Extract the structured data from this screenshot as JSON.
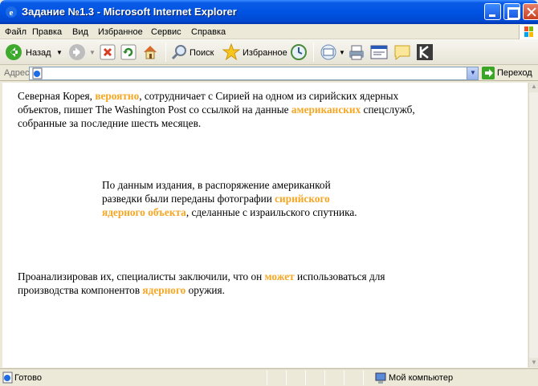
{
  "window": {
    "title": "Задание №1.3 - Microsoft Internet Explorer",
    "icon": "ie-icon"
  },
  "menu": {
    "file": "Файл",
    "edit": "Правка",
    "view": "Вид",
    "favorites": "Избранное",
    "tools": "Сервис",
    "help": "Справка"
  },
  "toolbar": {
    "back": "Назад",
    "search": "Поиск",
    "favorites": "Избранное"
  },
  "address": {
    "label": "Адрес:",
    "value": "",
    "go": "Переход"
  },
  "content": {
    "p1": {
      "a": "Северная Корея, ",
      "b": "вероятно",
      "c": ", сотрудничает с Сирией на одном из сирийских ядерных",
      "d": "объектов, пишет The Washington Post со ссылкой на данные ",
      "e": "американских",
      "f": " спецслужб,",
      "g": "собранные за последние шесть месяцев."
    },
    "p2": {
      "a": "По данным издания, в распоряжение американкой",
      "b": "разведки были переданы фотографии ",
      "c": "сирийского",
      "d": "ядерного объекта",
      "e": ", сделанные с израильского спутника."
    },
    "p3": {
      "a": "Проанализировав их, специалисты заключили, что он ",
      "b": "может",
      "c": " использоваться для",
      "d": "производства компонентов ",
      "e": "ядерного",
      "f": " оружия."
    }
  },
  "status": {
    "left": "Готово",
    "zone": "Мой компьютер"
  },
  "colors": {
    "highlight": "#F5A623",
    "titlebar": "#0054E3"
  }
}
